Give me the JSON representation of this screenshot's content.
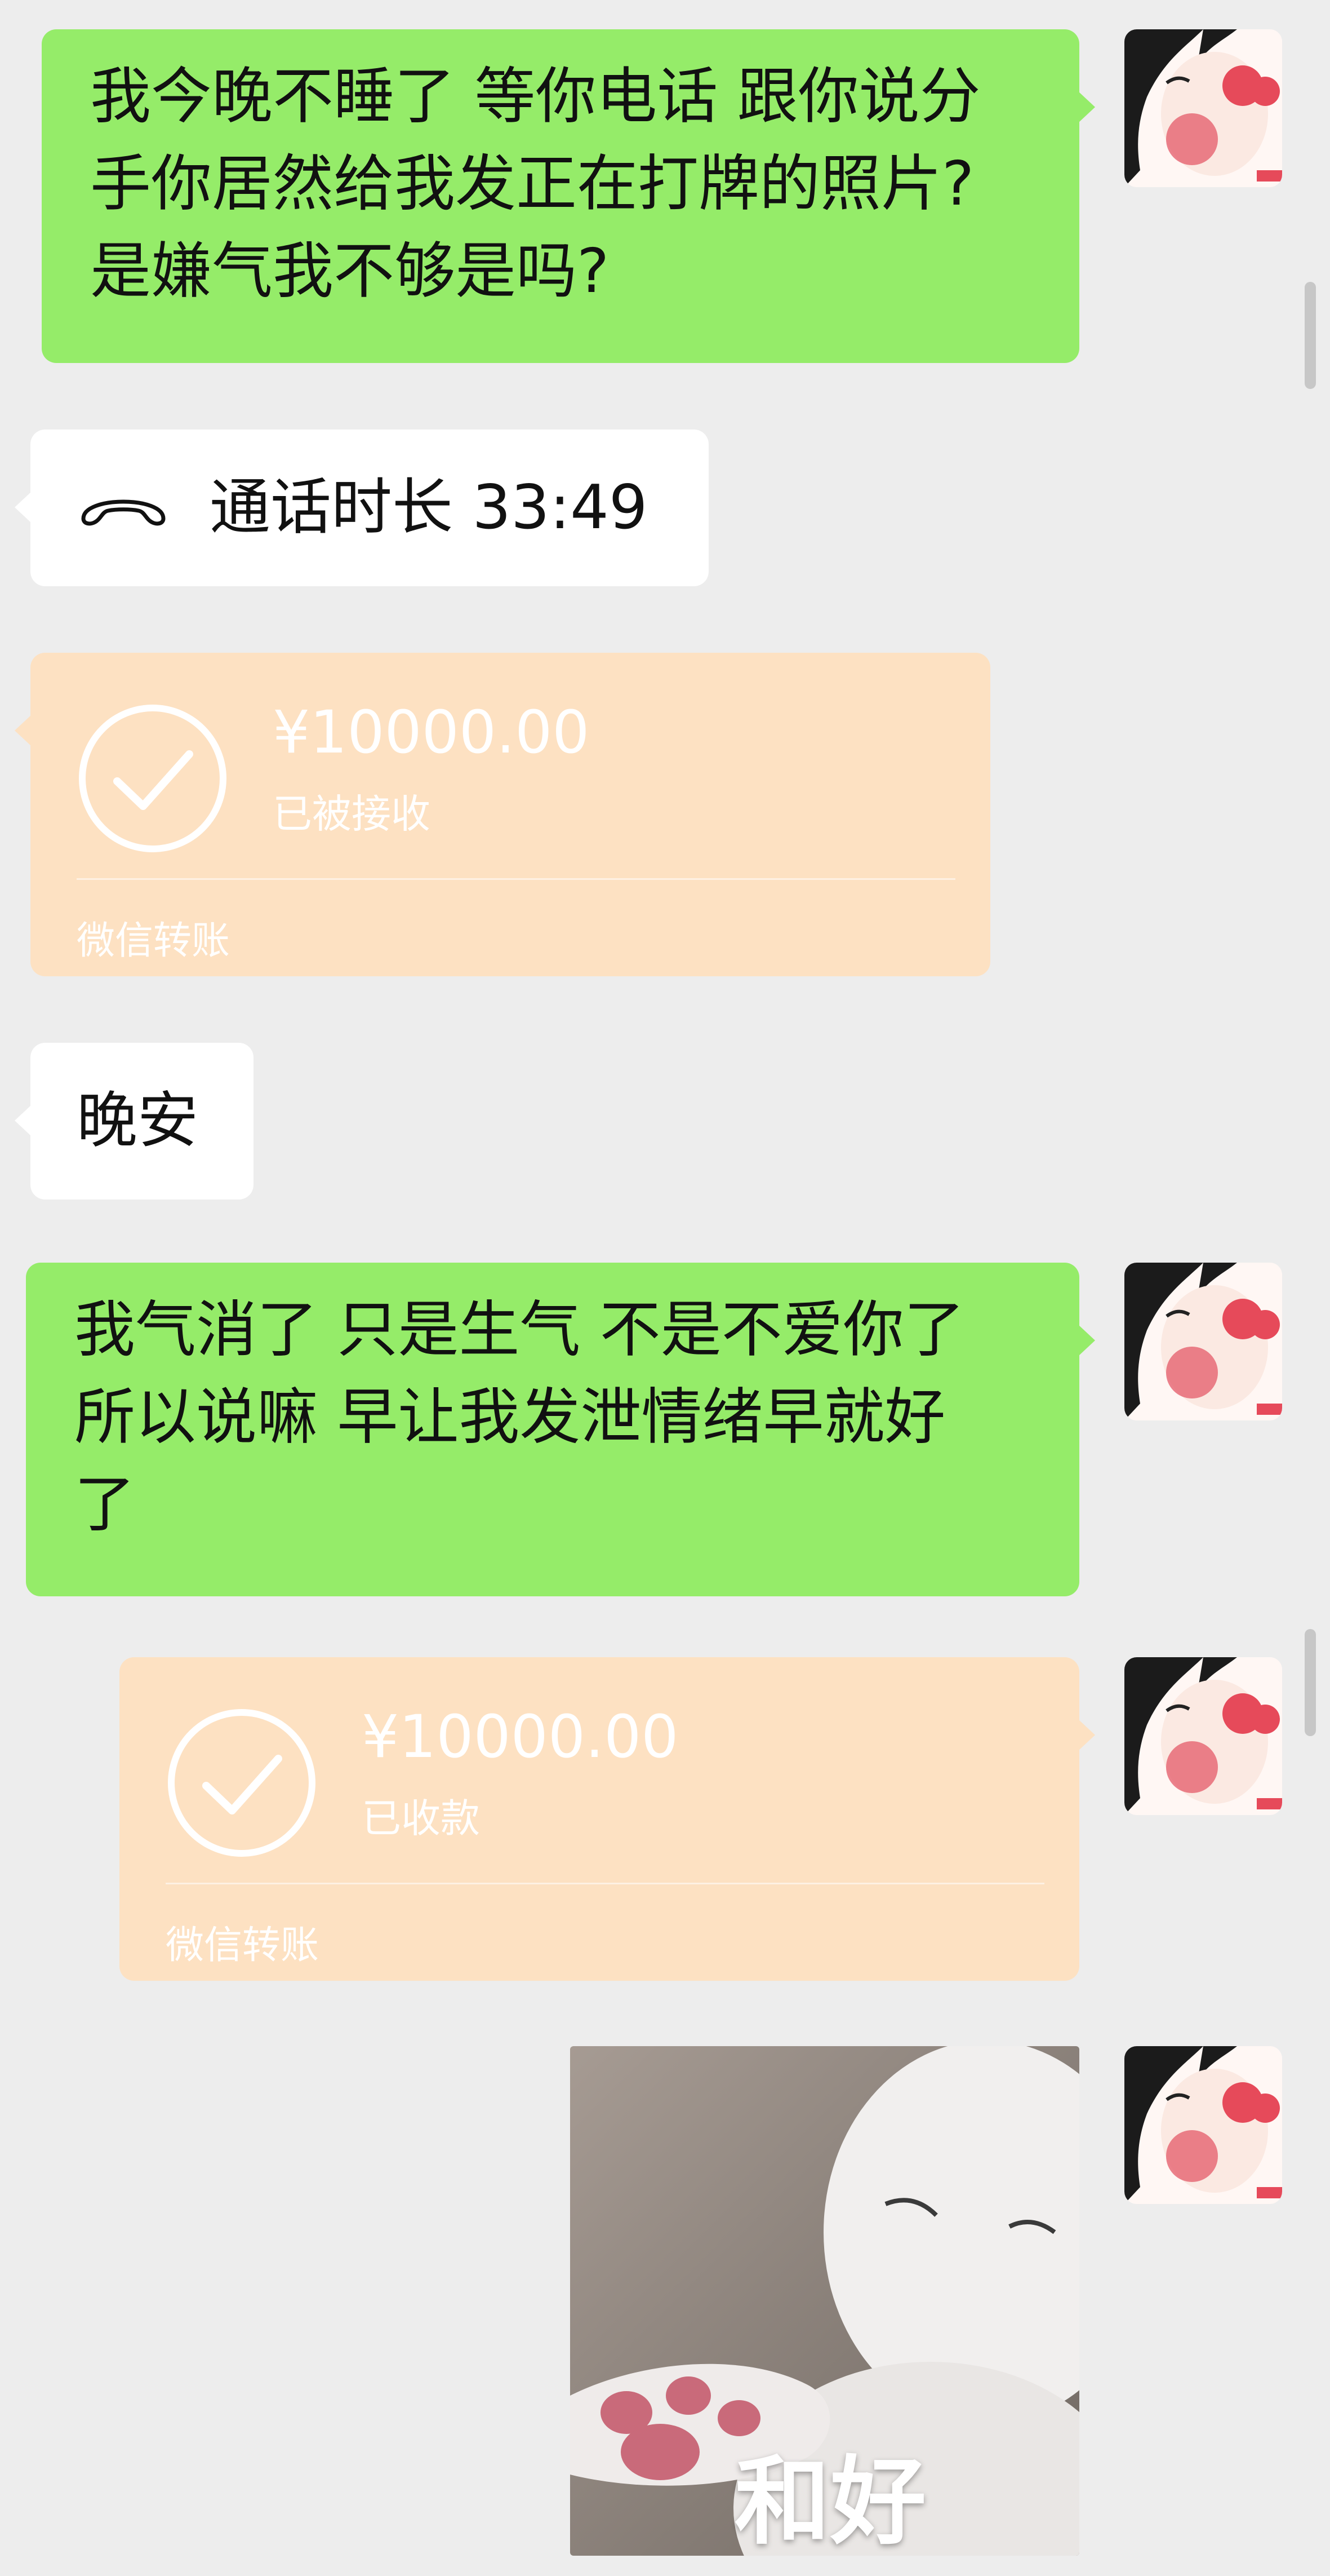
{
  "messages": [
    {
      "side": "right",
      "type": "text",
      "text": "我今晚不睡了 等你电话 跟你说分\n手你居然给我发正在打牌的照片?\n是嫌气我不够是吗?"
    },
    {
      "side": "left",
      "type": "call",
      "text": "通话时长 33:49",
      "icon": "phone-hangup-icon"
    },
    {
      "side": "left",
      "type": "transfer",
      "amount": "¥10000.00",
      "status": "已被接收",
      "label": "微信转账",
      "icon": "check-circle-icon"
    },
    {
      "side": "left",
      "type": "text",
      "text": "晚安"
    },
    {
      "side": "right",
      "type": "text",
      "text": "我气消了 只是生气 不是不爱你了\n所以说嘛 早让我发泄情绪早就好\n了"
    },
    {
      "side": "right",
      "type": "transfer",
      "amount": "¥10000.00",
      "status": "已收款",
      "label": "微信转账",
      "icon": "check-circle-icon"
    },
    {
      "side": "right",
      "type": "sticker",
      "caption": "和好",
      "icon": "cat-paw-sticker"
    }
  ],
  "colors": {
    "background": "#ededed",
    "self_bubble": "#95ec69",
    "other_bubble": "#ffffff",
    "transfer_bubble": "#fde1c2"
  }
}
